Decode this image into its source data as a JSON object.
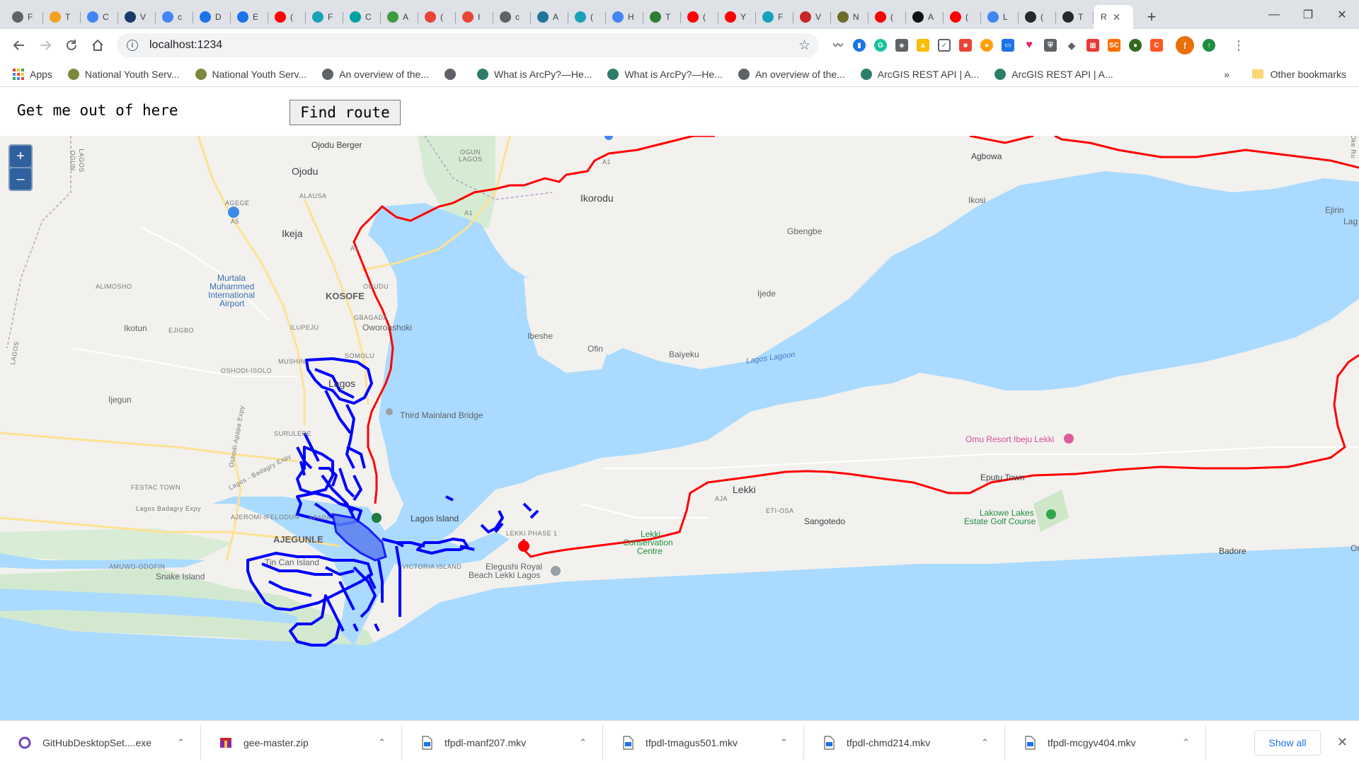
{
  "browser": {
    "tabs": [
      {
        "letter": "F",
        "color": "#5f6368",
        "icon": "globe-icon"
      },
      {
        "letter": "T",
        "color": "#f4a020",
        "icon": "gbs-icon"
      },
      {
        "letter": "C",
        "color": "#4285f4",
        "icon": "google-icon"
      },
      {
        "letter": "V",
        "color": "#1a3a6c",
        "icon": "arcgis-icon"
      },
      {
        "letter": "c",
        "color": "#4285f4",
        "icon": "google-icon"
      },
      {
        "letter": "D",
        "color": "#1a73e8",
        "icon": "download-icon"
      },
      {
        "letter": "E",
        "color": "#1a73e8",
        "icon": "puzzle-icon"
      },
      {
        "letter": "(",
        "color": "#ff0000",
        "icon": "youtube-icon"
      },
      {
        "letter": "F",
        "color": "#17a2b8",
        "icon": "t-icon"
      },
      {
        "letter": "C",
        "color": "#00a0a0",
        "icon": "layers-icon"
      },
      {
        "letter": "A",
        "color": "#3d9a3d",
        "icon": "cube-icon"
      },
      {
        "letter": "(",
        "color": "#ea4335",
        "icon": "gmail-icon"
      },
      {
        "letter": "I",
        "color": "#ea4335",
        "icon": "gmail-icon"
      },
      {
        "letter": "c",
        "color": "#5f6368",
        "icon": "globe-icon"
      },
      {
        "letter": "A",
        "color": "#21759b",
        "icon": "wordpress-icon"
      },
      {
        "letter": "(",
        "color": "#17a2b8",
        "icon": "t-icon"
      },
      {
        "letter": "H",
        "color": "#4285f4",
        "icon": "google-icon"
      },
      {
        "letter": "T",
        "color": "#2e7d32",
        "icon": "robot-icon"
      },
      {
        "letter": "(",
        "color": "#ff0000",
        "icon": "youtube-icon"
      },
      {
        "letter": "Y",
        "color": "#ff0000",
        "icon": "youtube-icon"
      },
      {
        "letter": "F",
        "color": "#17a2b8",
        "icon": "t-icon"
      },
      {
        "letter": "V",
        "color": "#c62828",
        "icon": "pen-icon"
      },
      {
        "letter": "N",
        "color": "#6d6d2a",
        "icon": "news-icon"
      },
      {
        "letter": "(",
        "color": "#ff0000",
        "icon": "youtube-icon"
      },
      {
        "letter": "A",
        "color": "#111111",
        "icon": "film-icon"
      },
      {
        "letter": "(",
        "color": "#ff0000",
        "icon": "youtube-icon"
      },
      {
        "letter": "L",
        "color": "#4285f4",
        "icon": "google-icon"
      },
      {
        "letter": "(",
        "color": "#24292e",
        "icon": "github-icon"
      },
      {
        "letter": "T",
        "color": "#24292e",
        "icon": "github-icon"
      }
    ],
    "active_tab": {
      "letter": "R",
      "close": "✕"
    },
    "new_tab": "+",
    "url": "localhost:1234",
    "window": {
      "minimize": "—",
      "restore": "❐",
      "close": "✕"
    }
  },
  "bookmarks": {
    "items": [
      {
        "label": "Apps",
        "icon": "apps-grid-icon"
      },
      {
        "label": "National Youth Serv...",
        "icon": "nysc-icon"
      },
      {
        "label": "National Youth Serv...",
        "icon": "nysc-icon"
      },
      {
        "label": "An overview of the...",
        "icon": "globe-icon"
      },
      {
        "label": "",
        "icon": "globe-icon"
      },
      {
        "label": "What is ArcPy?—He...",
        "icon": "arcgis-globe-icon"
      },
      {
        "label": "What is ArcPy?—He...",
        "icon": "arcgis-globe-icon"
      },
      {
        "label": "An overview of the...",
        "icon": "globe-icon"
      },
      {
        "label": "ArcGIS REST API | A...",
        "icon": "arcgis-globe-icon"
      },
      {
        "label": "ArcGIS REST API | A...",
        "icon": "arcgis-globe-icon"
      }
    ],
    "more": "»",
    "other": "Other bookmarks"
  },
  "page": {
    "title": "Get me out of here",
    "find_button": "Find route"
  },
  "map": {
    "zoom_in": "+",
    "zoom_out": "–",
    "labels": {
      "ojodu_berger": "Ojodu Berger",
      "ojodu": "Ojodu",
      "ikeja": "Ikeja",
      "ikorodu": "Ikorodu",
      "agbowa": "Agbowa",
      "ikosi": "Ikosi",
      "ejirin": "Ejirin",
      "lag": "Lag",
      "gbengbe": "Gbengbe",
      "ijede": "Ijede",
      "kosofe": "KOSOFE",
      "owoonshoki": "Oworonshoki",
      "airport1": "Murtala",
      "airport2": "Muhammed",
      "airport3": "International",
      "airport4": "Airport",
      "alimosho": "ALIMOSHO",
      "ikotun": "Ikotun",
      "ejigbo": "EJIGBO",
      "ilupeju": "ILUPEJU",
      "mushin": "MUSHIN",
      "somolu": "SOMOLU",
      "oshodi": "OSHODI-ISOLO",
      "lagos": "Lagos",
      "ijegun": "Ijegun",
      "third_mainland": "Third Mainland Bridge",
      "ibeshe": "Ibeshe",
      "ofin": "Ofin",
      "baiyeku": "Baiyeku",
      "lagos_lagoon": "Lagos Lagoon",
      "omu_resort": "Omu Resort Ibeju Lekki",
      "surulere": "SURULERE",
      "festac": "FESTAC TOWN",
      "badagry1": "Lagos - Badagry Expy",
      "badagry2": "Lagos Badagry Expy",
      "ajeromi": "AJEROMI-IFELODUN",
      "apapa": "APAPA",
      "lagos_island": "Lagos Island",
      "lekki": "Lekki",
      "aja": "AJA",
      "eti_osa": "ETI-OSA",
      "sangotedo": "Sangotedo",
      "eputu": "Eputu Town",
      "lakowe1": "Lakowe Lakes",
      "lakowe2": "Estate Golf Course",
      "badore": "Badore",
      "ajegunle": "AJEGUNLE",
      "tin_can": "Tin Can Island",
      "amuwo": "AMUWO-ODOFIN",
      "snake": "Snake Island",
      "victoria": "VICTORIA ISLAND",
      "lekki_phase": "LEKKI PHASE 1",
      "lekki_cons1": "Lekki",
      "lekki_cons2": "Conservation",
      "lekki_cons3": "Centre",
      "elegushi1": "Elegushi Royal",
      "elegushi2": "Beach Lekki Lagos",
      "oni": "Oni",
      "oke_ru": "Oke Ru",
      "ogun_lagos1": "OGUN",
      "ogun_lagos2": "LAGOS",
      "ogun_side1": "OGUN",
      "ogun_side2": "LAGOS",
      "alausa": "ALAUSA",
      "agege": "AGEGE",
      "ogudu": "OGUDU",
      "gbagada": "GBAGADA",
      "oworo": "Oworonshoki",
      "lagos_side": "LAGOS",
      "a1_1": "A1",
      "a1_2": "A1",
      "a1_3": "A1",
      "a5": "A5",
      "oshodi_expy": "Oshodi-Apapa Expy"
    }
  },
  "downloads": {
    "items": [
      {
        "name": "GitHubDesktopSet....exe",
        "icon": "github-desktop-icon"
      },
      {
        "name": "gee-master.zip",
        "icon": "zip-icon"
      },
      {
        "name": "tfpdl-manf207.mkv",
        "icon": "file-icon"
      },
      {
        "name": "tfpdl-tmagus501.mkv",
        "icon": "file-icon"
      },
      {
        "name": "tfpdl-chmd214.mkv",
        "icon": "file-icon"
      },
      {
        "name": "tfpdl-mcgyv404.mkv",
        "icon": "file-icon"
      }
    ],
    "chevron": "⌃",
    "show_all": "Show all",
    "close": "✕"
  }
}
